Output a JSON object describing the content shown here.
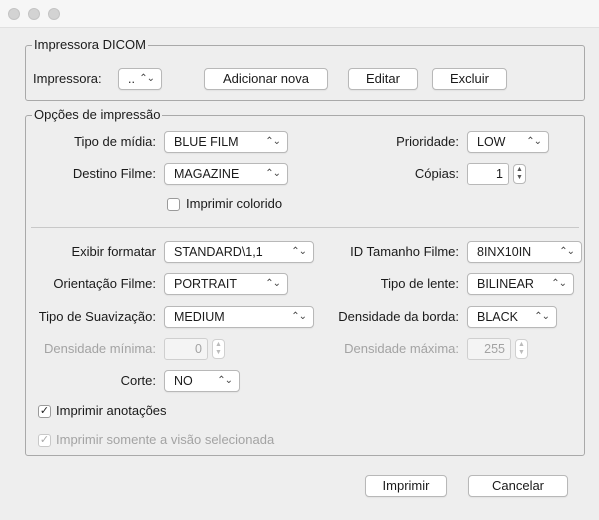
{
  "printer_group": {
    "legend": "Impressora DICOM",
    "printer_label": "Impressora:",
    "printer_value": "..",
    "add_label": "Adicionar nova",
    "edit_label": "Editar",
    "delete_label": "Excluir"
  },
  "options_group": {
    "legend": "Opções de impressão",
    "media_type": {
      "label": "Tipo de mídia:",
      "value": "BLUE FILM"
    },
    "priority": {
      "label": "Prioridade:",
      "value": "LOW"
    },
    "film_destination": {
      "label": "Destino Filme:",
      "value": "MAGAZINE"
    },
    "copies": {
      "label": "Cópias:",
      "value": "1"
    },
    "print_color": {
      "label": "Imprimir colorido",
      "checked": false
    },
    "display_format": {
      "label": "Exibir formatar",
      "value": "STANDARD\\1,1"
    },
    "film_size": {
      "label": "ID Tamanho Filme:",
      "value": "8INX10IN"
    },
    "film_orientation": {
      "label": "Orientação Filme:",
      "value": "PORTRAIT"
    },
    "lens_type": {
      "label": "Tipo de lente:",
      "value": "BILINEAR"
    },
    "smoothing_type": {
      "label": "Tipo de Suavização:",
      "value": "MEDIUM"
    },
    "border_density": {
      "label": "Densidade da borda:",
      "value": "BLACK"
    },
    "min_density": {
      "label": "Densidade mínima:",
      "value": "0"
    },
    "max_density": {
      "label": "Densidade máxima:",
      "value": "255"
    },
    "trim": {
      "label": "Corte:",
      "value": "NO"
    },
    "print_annotations": {
      "label": "Imprimir anotações",
      "checked": true
    },
    "print_selected_view": {
      "label": "Imprimir somente a visão selecionada",
      "checked": true
    }
  },
  "footer": {
    "print_label": "Imprimir",
    "cancel_label": "Cancelar"
  }
}
